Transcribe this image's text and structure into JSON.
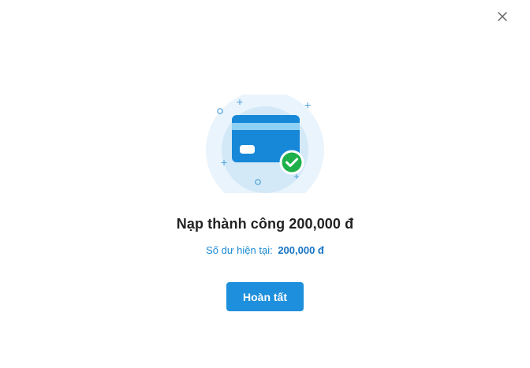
{
  "dialog": {
    "close_icon": "close-icon",
    "illustration_icon": "credit-card-success-icon",
    "title": "Nạp thành công 200,000 đ",
    "balance_label": "Số dư hiện tại:",
    "balance_amount": "200,000 đ",
    "done_label": "Hoàn tất"
  },
  "colors": {
    "accent": "#1e8fdc",
    "balance_text": "#1a8ad4",
    "success": "#1eb04a",
    "title_text": "#222222"
  }
}
